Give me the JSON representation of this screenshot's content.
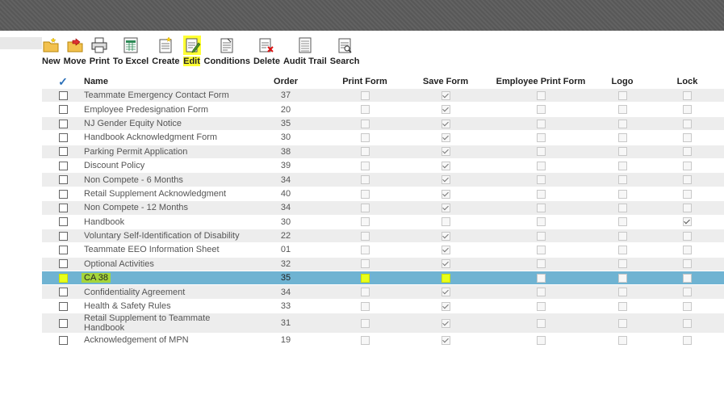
{
  "toolbar": {
    "items": [
      {
        "label": "New",
        "icon": "new-folder-icon"
      },
      {
        "label": "Move",
        "icon": "move-folder-icon"
      },
      {
        "label": "Print",
        "icon": "printer-icon"
      },
      {
        "label": "To Excel",
        "icon": "excel-icon"
      },
      {
        "label": "Create",
        "icon": "create-document-icon"
      },
      {
        "label": "Edit",
        "icon": "edit-document-icon"
      },
      {
        "label": "Conditions",
        "icon": "conditions-icon"
      },
      {
        "label": "Delete",
        "icon": "delete-document-icon"
      },
      {
        "label": "Audit Trail",
        "icon": "audit-trail-icon"
      },
      {
        "label": "Search",
        "icon": "search-document-icon"
      }
    ],
    "active": "Edit"
  },
  "table": {
    "header_check": "✓",
    "columns": [
      "Name",
      "Order",
      "Print Form",
      "Save Form",
      "Employee Print Form",
      "Logo",
      "Lock"
    ],
    "rows": [
      {
        "name": "Teammate Emergency Contact Form",
        "order": "37",
        "print": false,
        "save": true,
        "emp": false,
        "logo": false,
        "lock": false
      },
      {
        "name": "Employee Predesignation Form",
        "order": "20",
        "print": false,
        "save": true,
        "emp": false,
        "logo": false,
        "lock": false
      },
      {
        "name": "NJ Gender Equity Notice",
        "order": "35",
        "print": false,
        "save": true,
        "emp": false,
        "logo": false,
        "lock": false
      },
      {
        "name": "Handbook Acknowledgment Form",
        "order": "30",
        "print": false,
        "save": true,
        "emp": false,
        "logo": false,
        "lock": false
      },
      {
        "name": "Parking Permit Application",
        "order": "38",
        "print": false,
        "save": true,
        "emp": false,
        "logo": false,
        "lock": false
      },
      {
        "name": "Discount Policy",
        "order": "39",
        "print": false,
        "save": true,
        "emp": false,
        "logo": false,
        "lock": false
      },
      {
        "name": "Non Compete - 6 Months",
        "order": "34",
        "print": false,
        "save": true,
        "emp": false,
        "logo": false,
        "lock": false
      },
      {
        "name": "Retail Supplement Acknowledgment",
        "order": "40",
        "print": false,
        "save": true,
        "emp": false,
        "logo": false,
        "lock": false
      },
      {
        "name": "Non Compete - 12 Months",
        "order": "34",
        "print": false,
        "save": true,
        "emp": false,
        "logo": false,
        "lock": false
      },
      {
        "name": "Handbook",
        "order": "30",
        "print": false,
        "save": false,
        "emp": false,
        "logo": false,
        "lock": true
      },
      {
        "name": "Voluntary Self-Identification of Disability",
        "order": "22",
        "print": false,
        "save": true,
        "emp": false,
        "logo": false,
        "lock": false
      },
      {
        "name": "Teammate EEO Information Sheet",
        "order": "01",
        "print": false,
        "save": true,
        "emp": false,
        "logo": false,
        "lock": false
      },
      {
        "name": "Optional Activities",
        "order": "32",
        "print": false,
        "save": true,
        "emp": false,
        "logo": false,
        "lock": false
      },
      {
        "name": "CA 38",
        "order": "35",
        "print": false,
        "save": false,
        "emp": false,
        "logo": false,
        "lock": false,
        "selected": true
      },
      {
        "name": "Confidentiality Agreement",
        "order": "34",
        "print": false,
        "save": true,
        "emp": false,
        "logo": false,
        "lock": false
      },
      {
        "name": "Health & Safety Rules",
        "order": "33",
        "print": false,
        "save": true,
        "emp": false,
        "logo": false,
        "lock": false
      },
      {
        "name": "Retail Supplement to Teammate Handbook",
        "order": "31",
        "print": false,
        "save": true,
        "emp": false,
        "logo": false,
        "lock": false
      },
      {
        "name": "Acknowledgement of MPN",
        "order": "19",
        "print": false,
        "save": true,
        "emp": false,
        "logo": false,
        "lock": false
      }
    ]
  },
  "colors": {
    "selected_row": "#6fb3d2",
    "highlight": "#e8ff1a",
    "marker": "#8cc61e",
    "header_check": "#2a6fb8"
  }
}
